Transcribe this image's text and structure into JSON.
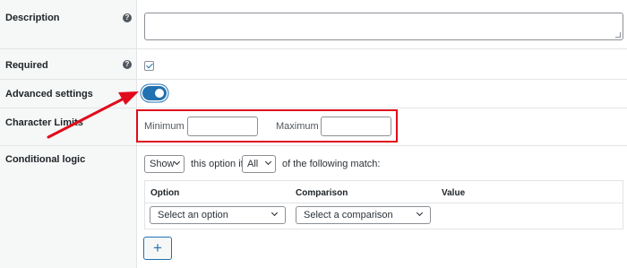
{
  "rows": {
    "description": {
      "label": "Description"
    },
    "required": {
      "label": "Required",
      "checked": true
    },
    "advanced": {
      "label": "Advanced settings",
      "enabled": true
    },
    "char_limits": {
      "label": "Character Limits",
      "minimum_label": "Minimum",
      "maximum_label": "Maximum",
      "minimum_value": "",
      "maximum_value": ""
    },
    "conditional": {
      "label": "Conditional logic"
    }
  },
  "help_icon_glyph": "?",
  "conditional_logic": {
    "action_select": "Show",
    "text_1": "this option if",
    "match_select": "All",
    "text_2": "of the following match:",
    "table_headers": {
      "option": "Option",
      "comparison": "Comparison",
      "value": "Value"
    },
    "option_select": "Select an option",
    "comparison_select": "Select a comparison",
    "add_button": "+"
  },
  "colors": {
    "accent": "#2271b1",
    "highlight": "#e00b1b"
  }
}
